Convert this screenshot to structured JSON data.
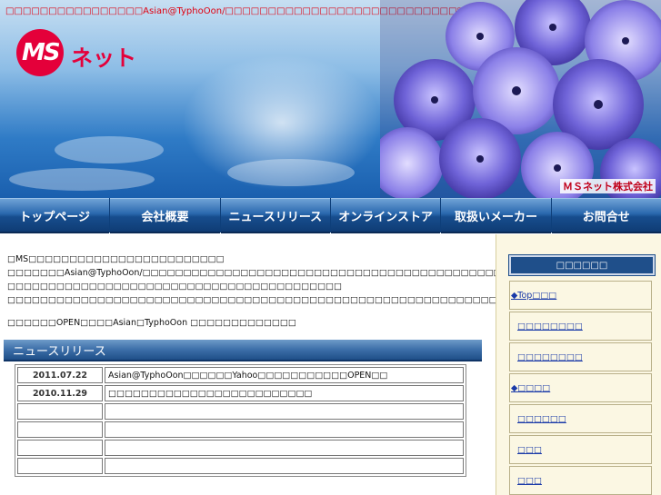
{
  "header": {
    "notice": "□□□□□□□□□□□□□□□□Asian@TyphoOon/□□□□□□□□□□□□□□□□□□□□□□□□□□□□□□□",
    "logo_ms": "MS",
    "logo_net": "ネット",
    "company_caption": "ＭＳネット株式会社"
  },
  "nav": [
    {
      "label": "トップページ"
    },
    {
      "label": "会社概要"
    },
    {
      "label": "ニュースリリース"
    },
    {
      "label": "オンラインストア"
    },
    {
      "label": "取扱いメーカー"
    },
    {
      "label": "お問合せ"
    }
  ],
  "intro": {
    "line1": "□MS□□□□□□□□□□□□□□□□□□□□□□□□",
    "line2": "□□□□□□□Asian@TyphoOon/□□□□□□□□□□□□□□□□□□□□□□□□□□□□□□□□□□□□□□□□□□□□□□□□□□□□",
    "line3": "□□□□□□□□□□□□□□□□□□□□□□□□□□□□□□□□□□□□□□□□□",
    "line4": "□□□□□□□□□□□□□□□□□□□□□□□□□□□□□□□□□□□□□□□□□□□□□□□□□□□□□□□□□□□□□□□",
    "line5": "□□□□□□OPEN□□□□Asian□TyphoOon □□□□□□□□□□□□□"
  },
  "news": {
    "heading": "ニュースリリース",
    "rows": [
      {
        "date": "2011.07.22",
        "text": "Asian@TyphoOon□□□□□□Yahoo□□□□□□□□□□□OPEN□□"
      },
      {
        "date": "2010.11.29",
        "text": "□□□□□□□□□□□□□□□□□□□□□□□□□"
      },
      {
        "date": "",
        "text": ""
      },
      {
        "date": "",
        "text": ""
      },
      {
        "date": "",
        "text": ""
      },
      {
        "date": "",
        "text": ""
      }
    ]
  },
  "sidebar": {
    "title": "□□□□□□",
    "items": [
      {
        "label": "◆Top□□□"
      },
      {
        "label": "□□□□□□□□"
      },
      {
        "label": "□□□□□□□□"
      },
      {
        "label": "◆□□□□"
      },
      {
        "label": "□□□□□□"
      },
      {
        "label": "□□□"
      },
      {
        "label": "□□□"
      }
    ]
  },
  "colors": {
    "notice_red": "#e00010",
    "logo_red": "#e4003a",
    "nav_blue": "#174d8e",
    "sidebar_bg": "#fbf7e3",
    "link_blue": "#1a3aa8"
  }
}
